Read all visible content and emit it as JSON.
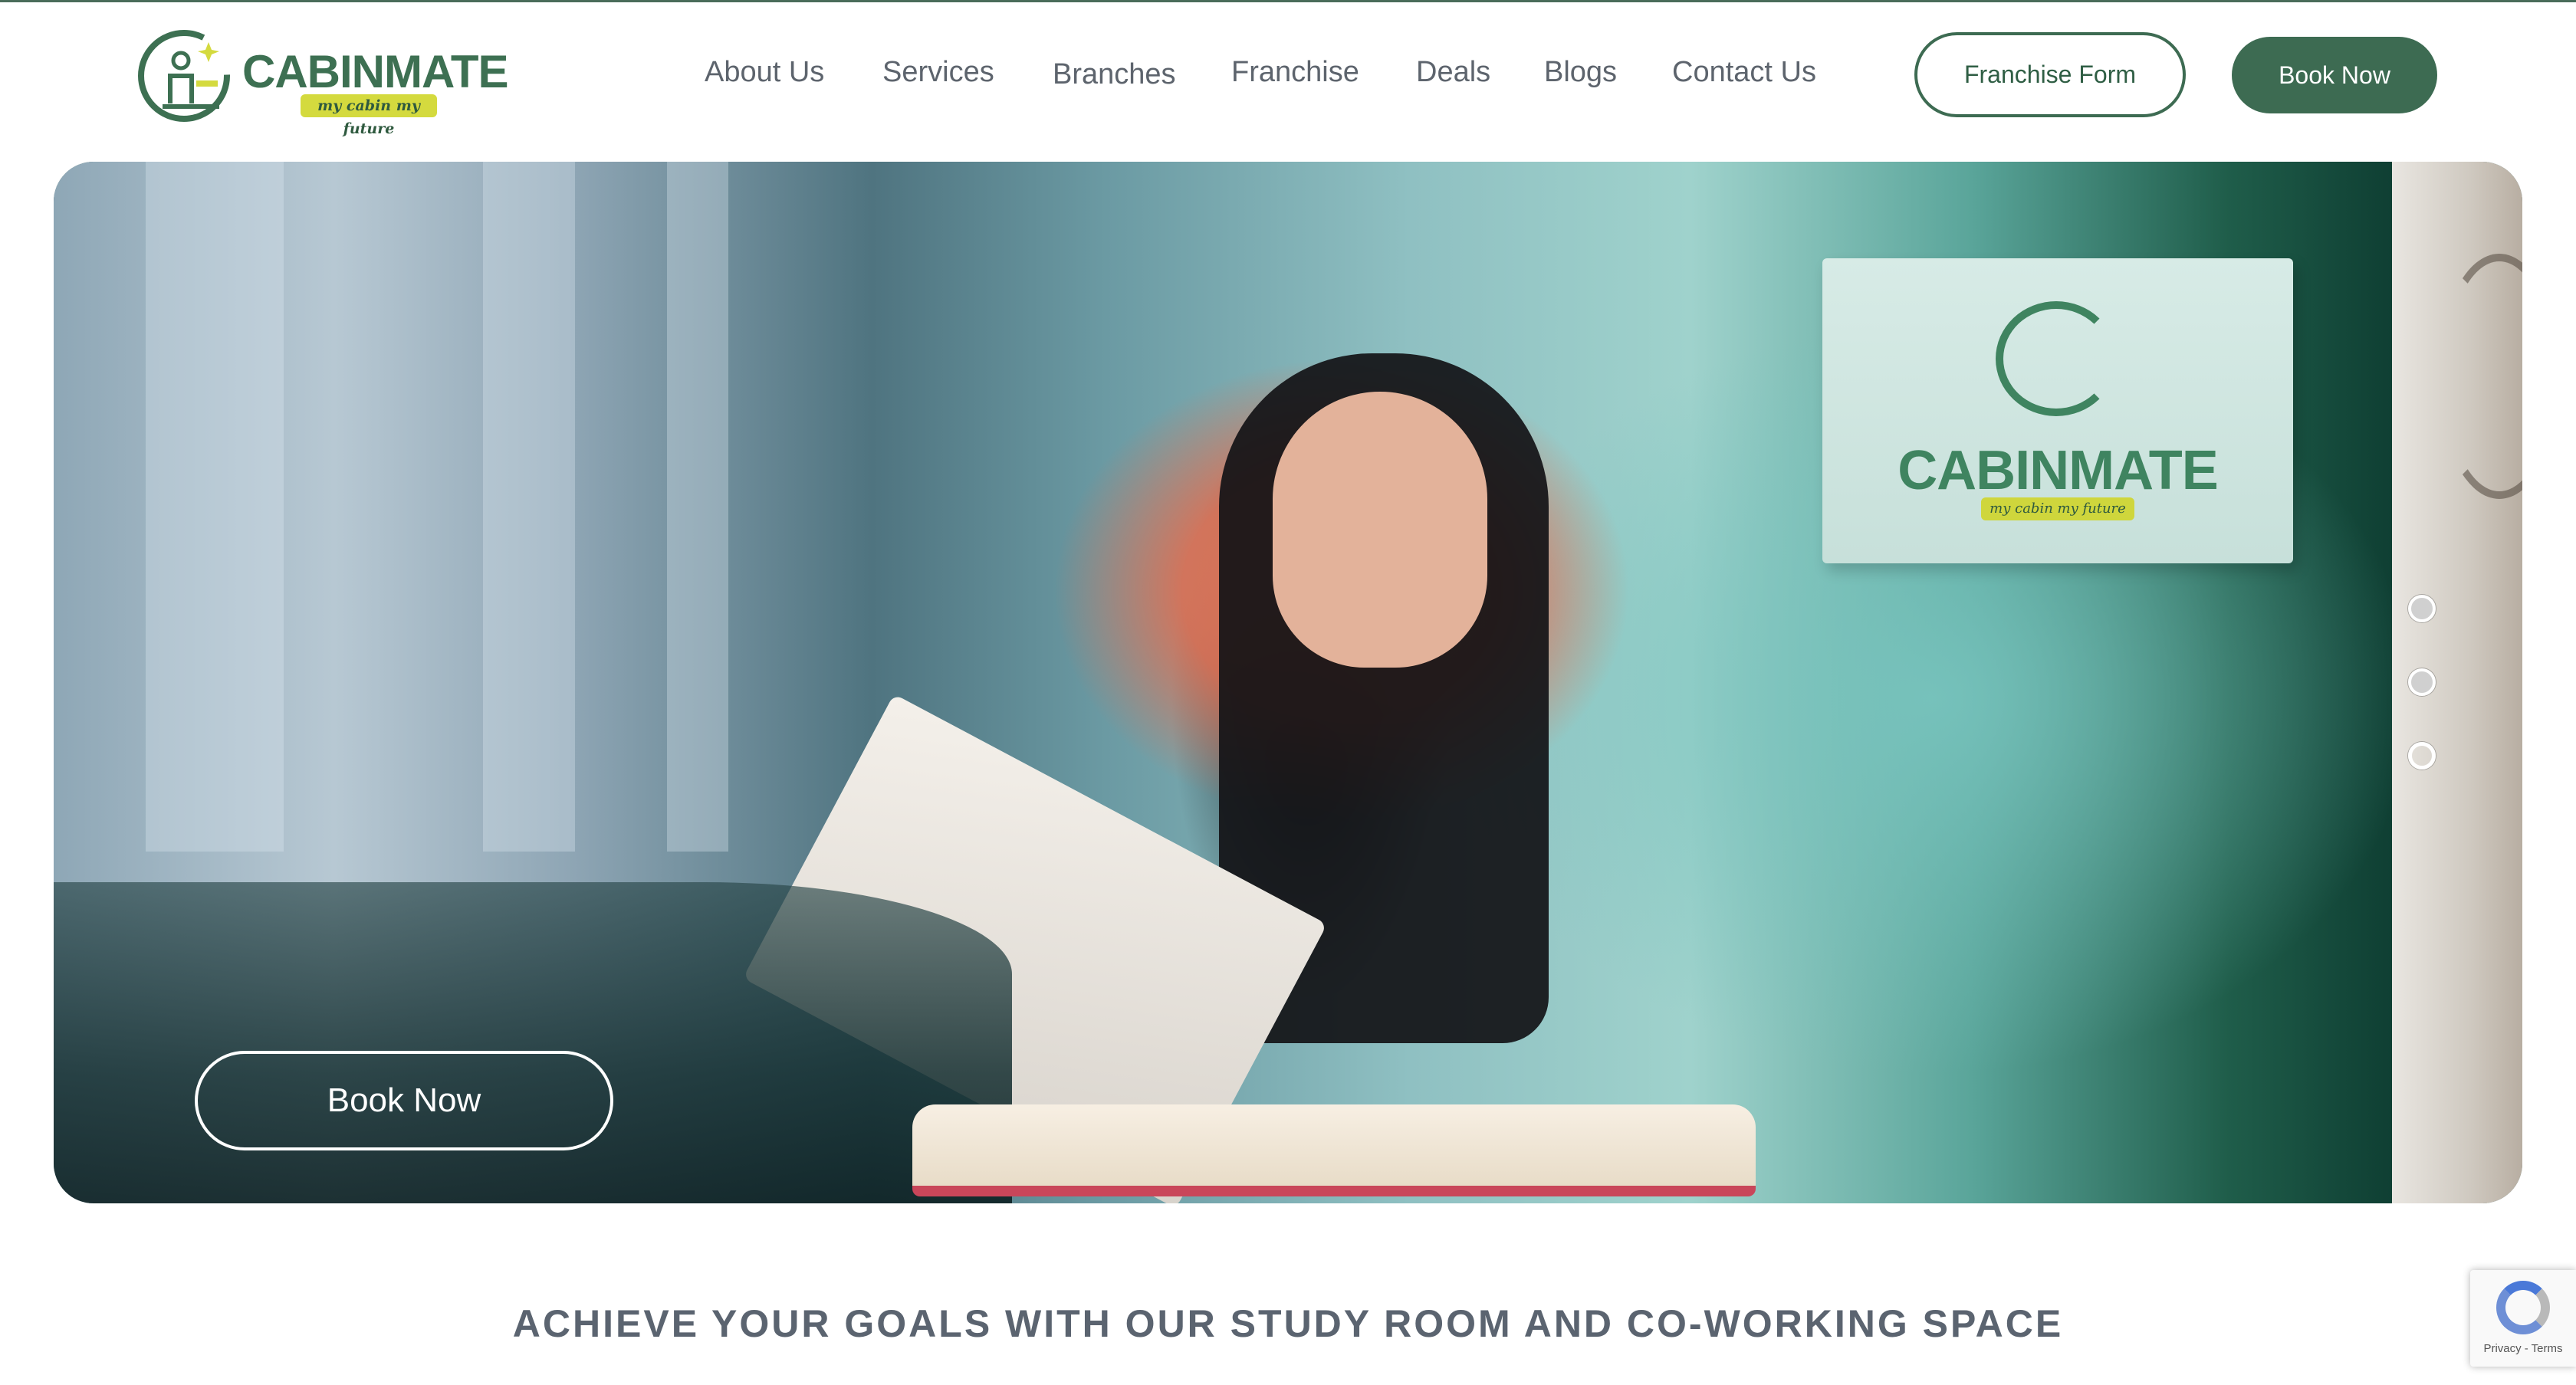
{
  "brand": {
    "name": "CABINMATE",
    "tagline": "my cabin my future",
    "accent": "#3d6b52",
    "tagline_bg": "#d4da3e"
  },
  "nav": {
    "items": [
      "About Us",
      "Services",
      "Branches",
      "Franchise",
      "Deals",
      "Blogs",
      "Contact Us"
    ]
  },
  "header": {
    "franchise_form_label": "Franchise Form",
    "book_now_label": "Book Now"
  },
  "hero": {
    "sign_brand": "CABINMATE",
    "sign_tagline": "my cabin my future",
    "book_now_label": "Book Now",
    "slides_total": 3,
    "active_slide": 3
  },
  "section": {
    "title": "ACHIEVE YOUR GOALS WITH OUR STUDY ROOM AND CO-WORKING SPACE"
  },
  "recaptcha": {
    "links": "Privacy - Terms"
  }
}
